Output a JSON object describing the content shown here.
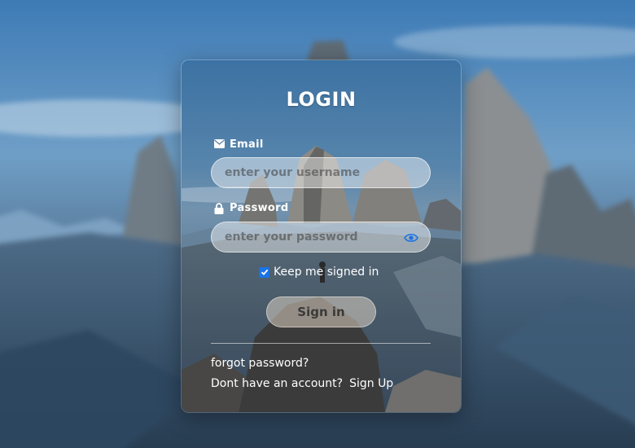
{
  "login": {
    "title": "LOGIN",
    "email_label": "Email",
    "email_placeholder": "enter your username",
    "password_label": "Password",
    "password_placeholder": "enter your password",
    "keep_signed_in_label": "Keep me signed in",
    "keep_signed_in_checked": true,
    "signin_label": "Sign in",
    "forgot_label": "forgot password?",
    "no_account_text": "Dont have an account?",
    "signup_label": "Sign Up"
  },
  "icons": {
    "email": "envelope-icon",
    "password": "lock-icon",
    "reveal": "eye-icon",
    "check": "checkmark-icon"
  },
  "colors": {
    "checkbox": "#1a73e8",
    "eye": "#1a73e8"
  }
}
